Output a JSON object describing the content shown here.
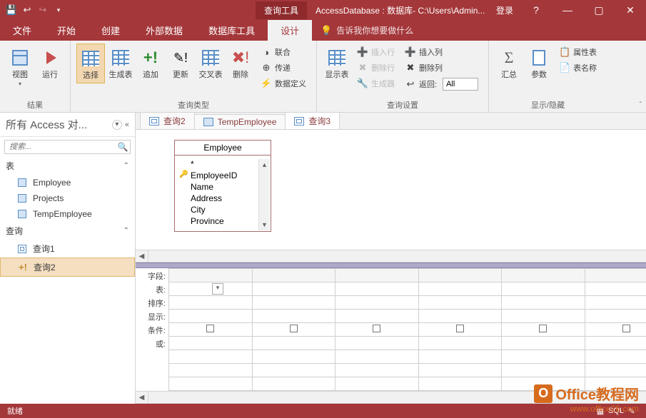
{
  "titlebar": {
    "context_tab": "查询工具",
    "title": "AccessDatabase : 数据库- C:\\Users\\Admin...",
    "login": "登录"
  },
  "tabs": {
    "file": "文件",
    "home": "开始",
    "create": "创建",
    "external": "外部数据",
    "dbtools": "数据库工具",
    "design": "设计",
    "tell_me": "告诉我你想要做什么"
  },
  "ribbon": {
    "results": {
      "view": "视图",
      "run": "运行",
      "label": "结果"
    },
    "qtype": {
      "select": "选择",
      "make": "生成表",
      "append": "追加",
      "update": "更新",
      "crosstab": "交叉表",
      "delete": "删除",
      "union": "联合",
      "pass": "传递",
      "ddl": "数据定义",
      "label": "查询类型"
    },
    "setup": {
      "show": "显示表",
      "ins_row": "插入行",
      "del_row": "删除行",
      "builder": "生成器",
      "ins_col": "插入列",
      "del_col": "删除列",
      "return": "返回:",
      "return_val": "All",
      "label": "查询设置"
    },
    "showhide": {
      "totals": "汇总",
      "params": "参数",
      "prop": "属性表",
      "tnames": "表名称",
      "label": "显示/隐藏"
    }
  },
  "nav": {
    "header": "所有 Access 对...",
    "search_ph": "搜索...",
    "tables_hdr": "表",
    "tables": [
      "Employee",
      "Projects",
      "TempEmployee"
    ],
    "queries_hdr": "查询",
    "queries": [
      "查询1",
      "查询2"
    ]
  },
  "doctabs": [
    "查询2",
    "TempEmployee",
    "查询3"
  ],
  "fieldbox": {
    "title": "Employee",
    "fields": [
      "*",
      "EmployeeID",
      "Name",
      "Address",
      "City",
      "Province"
    ]
  },
  "gridrows": [
    "字段:",
    "表:",
    "排序:",
    "显示:",
    "条件:",
    "或:"
  ],
  "status": "就绪",
  "watermark": {
    "brand": "Office教程网",
    "url": "www.office26.com"
  }
}
